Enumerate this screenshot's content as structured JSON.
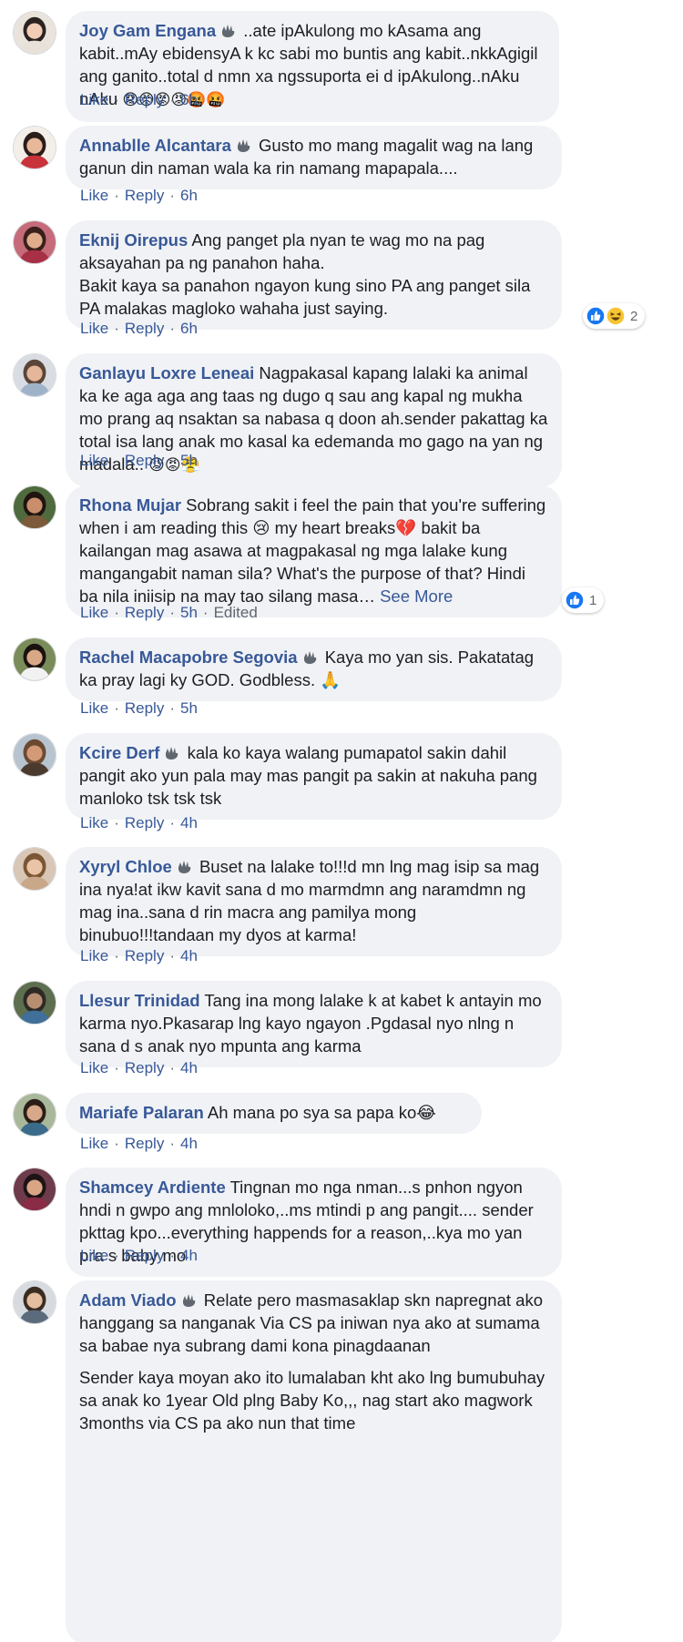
{
  "comments": [
    {
      "author": "Joy Gam Engana",
      "badge": true,
      "text": "..ate ipAkulong mo kAsama ang kabit..mAy ebidensyA k kc sabi mo buntis ang kabit..nkkAgigil ang ganito..total d nmn xa ngssuporta ei d ipAkulong..nAku nAku",
      "emoji": "😡😡😡😡🤬🤬",
      "like": "Like",
      "reply": "Reply",
      "time": "6h",
      "avatar": {
        "bg": "#e9e3dc",
        "skin": "#f2cdb5",
        "hair": "#2b2320",
        "shirt": "#e8e1da"
      }
    },
    {
      "author": "Annablle Alcantara",
      "badge": true,
      "text": "Gusto mo mang magalit wag na lang ganun din naman wala ka rin namang mapapala....",
      "like": "Like",
      "reply": "Reply",
      "time": "6h",
      "avatar": {
        "bg": "#f3efe8",
        "skin": "#e7b89a",
        "hair": "#2a1c18",
        "shirt": "#c8323a"
      }
    },
    {
      "author": "Eknij Oirepus",
      "badge": false,
      "text": "Ang panget pla nyan te wag mo na pag aksayahan pa ng panahon haha.",
      "text2": "Bakit kaya sa panahon ngayon kung sino PA ang panget sila PA malakas magloko wahaha just saying.",
      "like": "Like",
      "reply": "Reply",
      "time": "6h",
      "reactions": {
        "icons": [
          "like-icon",
          "haha-icon"
        ],
        "count": "2"
      },
      "avatar": {
        "bg": "#c56b7a",
        "skin": "#e0ad8c",
        "hair": "#3a1f1a",
        "shirt": "#a83046"
      }
    },
    {
      "author": "Ganlayu Loxre Leneai",
      "badge": false,
      "text": "Nagpakasal kapang lalaki ka animal ka ke aga aga ang taas ng dugo q sau ang kapal ng mukha mo prang aq nsaktan sa nabasa q doon ah.sender pakattag ka total isa lang anak mo kasal ka edemanda mo gago na yan ng madala..",
      "emoji": "😡😡😤",
      "like": "Like",
      "reply": "Reply",
      "time": "5h",
      "avatar": {
        "bg": "#d9dde3",
        "skin": "#e4b69a",
        "hair": "#5a4538",
        "shirt": "#9fb3c8"
      }
    },
    {
      "author": "Rhona Mujar",
      "badge": false,
      "text": "Sobrang sakit i feel the pain that you're suffering when i am reading this 😢 my heart breaks💔 bakit ba kailangan mag asawa at magpakasal ng mga lalake kung mangangabit naman sila? What's the purpose of that? Hindi ba nila iniisip na may tao silang masa…",
      "see_more": "See More",
      "like": "Like",
      "reply": "Reply",
      "time": "5h",
      "edited": "Edited",
      "reactions": {
        "icons": [
          "like-icon"
        ],
        "count": "1"
      },
      "avatar": {
        "bg": "#4f6b3e",
        "skin": "#c98e6c",
        "hair": "#1f1410",
        "shirt": "#7c5a3a"
      }
    },
    {
      "author": "Rachel Macapobre Segovia",
      "badge": true,
      "text": "Kaya mo yan sis. Pakatatag ka pray lagi ky GOD. Godbless. 🙏",
      "like": "Like",
      "reply": "Reply",
      "time": "5h",
      "avatar": {
        "bg": "#7a8c5a",
        "skin": "#d8a887",
        "hair": "#1a1210",
        "shirt": "#f2f2f2"
      }
    },
    {
      "author": "Kcire Derf",
      "badge": true,
      "text": "kala ko kaya walang pumapatol sakin dahil pangit ako yun pala may mas pangit pa sakin at nakuha pang manloko tsk tsk tsk",
      "like": "Like",
      "reply": "Reply",
      "time": "4h",
      "avatar": {
        "bg": "#b7c4cf",
        "skin": "#d49a78",
        "hair": "#6b4a33",
        "shirt": "#4a3a2e"
      }
    },
    {
      "author": "Xyryl Chloe",
      "badge": true,
      "text": "Buset na lalake to!!!d mn lng mag isip sa mag ina nya!at ikw kavit sana d mo marmdmn ang naramdmn ng mag ina..sana d rin macra ang pamilya mong binubuo!!!tandaan my dyos at karma!",
      "like": "Like",
      "reply": "Reply",
      "time": "4h",
      "avatar": {
        "bg": "#d8c6b6",
        "skin": "#ebc4a8",
        "hair": "#7a5634",
        "shirt": "#c9a88a"
      }
    },
    {
      "author": "Llesur Trinidad",
      "badge": false,
      "text": "Tang ina mong lalake k at kabet k antayin mo karma nyo.Pkasarap lng kayo ngayon .Pgdasal nyo nlng n sana d s anak nyo mpunta ang karma",
      "like": "Like",
      "reply": "Reply",
      "time": "4h",
      "avatar": {
        "bg": "#5d6f4e",
        "skin": "#b78e70",
        "hair": "#2d2a26",
        "shirt": "#3f6f9a"
      }
    },
    {
      "author": "Mariafe Palaran",
      "badge": false,
      "text": "Ah mana po sya sa papa ko😂",
      "like": "Like",
      "reply": "Reply",
      "time": "4h",
      "avatar": {
        "bg": "#a9b89a",
        "skin": "#d7a889",
        "hair": "#2b1e18",
        "shirt": "#3a6b8a"
      }
    },
    {
      "author": "Shamcey Ardiente",
      "badge": false,
      "text": "Tingnan mo nga nman...s pnhon ngyon hndi n gwpo ang mnloloko,..ms mtindi p ang pangit.... sender pkttag kpo...everything happends for a reason,..kya mo yan pra s baby mo",
      "like": "Like",
      "reply": "Reply",
      "time": "4h",
      "avatar": {
        "bg": "#6d3b4a",
        "skin": "#d9a585",
        "hair": "#1e1416",
        "shirt": "#8a2c45"
      }
    },
    {
      "author": "Adam Viado",
      "badge": true,
      "text": "Relate pero masmasaklap skn napregnat ako hanggang sa nanganak Via CS pa iniwan nya ako at sumama sa babae nya subrang dami kona pinagdaanan",
      "text2": "Sender kaya moyan ako ito lumalaban kht ako lng bumubuhay sa anak ko 1year Old plng Baby Ko,,, nag start ako magwork 3months via CS pa ako nun that time",
      "avatar": {
        "bg": "#d7dbe0",
        "skin": "#e5bd9f",
        "hair": "#3b2c22",
        "shirt": "#5b6b7c"
      }
    }
  ]
}
